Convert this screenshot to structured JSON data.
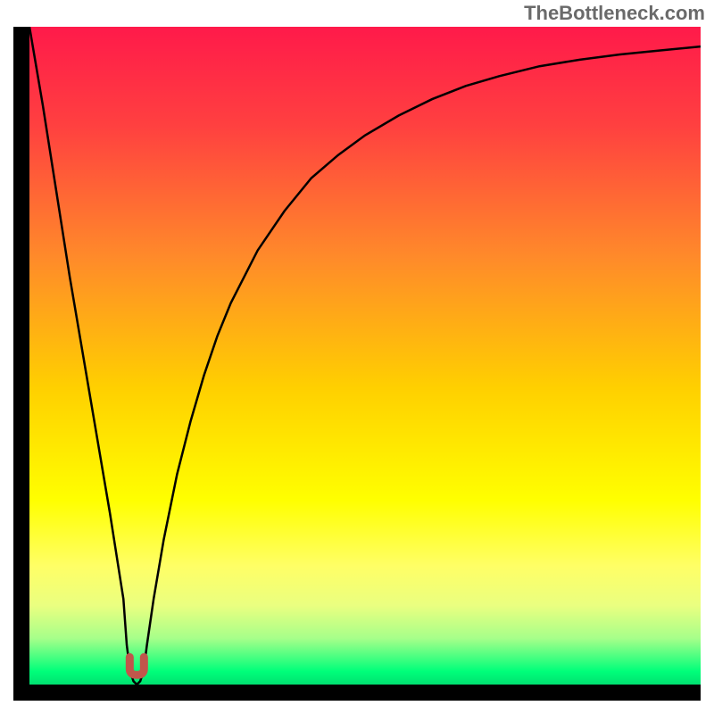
{
  "watermark": "TheBottleneck.com",
  "chart_data": {
    "type": "line",
    "title": "",
    "xlabel": "",
    "ylabel": "",
    "xlim": [
      0,
      100
    ],
    "ylim": [
      0,
      100
    ],
    "background_gradient": {
      "stops": [
        {
          "offset": 0,
          "color": "#ff1a4a"
        },
        {
          "offset": 15,
          "color": "#ff4040"
        },
        {
          "offset": 35,
          "color": "#ff8a2a"
        },
        {
          "offset": 55,
          "color": "#ffd000"
        },
        {
          "offset": 72,
          "color": "#ffff00"
        },
        {
          "offset": 82,
          "color": "#ffff66"
        },
        {
          "offset": 88,
          "color": "#eaff80"
        },
        {
          "offset": 93,
          "color": "#a6ff8a"
        },
        {
          "offset": 98,
          "color": "#00ff7a"
        },
        {
          "offset": 100,
          "color": "#00e070"
        }
      ]
    },
    "series": [
      {
        "name": "bottleneck-curve",
        "color": "#000000",
        "x": [
          0,
          2,
          4,
          6,
          8,
          10,
          12,
          14,
          14.5,
          15.0,
          15.5,
          16.0,
          16.5,
          17.0,
          17.5,
          18.5,
          20,
          22,
          24,
          26,
          28,
          30,
          34,
          38,
          42,
          46,
          50,
          55,
          60,
          65,
          70,
          76,
          82,
          88,
          94,
          100
        ],
        "values": [
          100,
          88,
          75,
          62,
          50,
          38,
          26,
          13,
          6,
          2,
          0.5,
          0,
          0.5,
          2,
          6,
          13,
          22,
          32,
          40,
          47,
          53,
          58,
          66,
          72,
          77,
          80.5,
          83.5,
          86.5,
          89,
          91,
          92.5,
          94,
          95,
          95.8,
          96.4,
          97
        ]
      }
    ],
    "marker": {
      "x": 16.0,
      "y": 2,
      "shape": "u",
      "color": "#c0564b"
    }
  }
}
